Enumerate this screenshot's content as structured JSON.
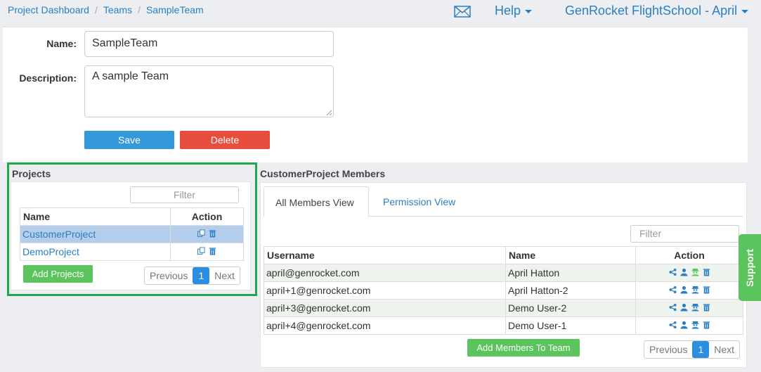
{
  "breadcrumb": [
    "Project Dashboard",
    "Teams",
    "SampleTeam"
  ],
  "header": {
    "help_label": "Help",
    "org_label": "GenRocket FlightSchool - April"
  },
  "form": {
    "name_label": "Name:",
    "name_value": "SampleTeam",
    "description_label": "Description:",
    "description_value": "A sample Team",
    "save_label": "Save",
    "delete_label": "Delete"
  },
  "projects": {
    "title": "Projects",
    "filter_placeholder": "Filter",
    "columns": [
      "Name",
      "Action"
    ],
    "rows": [
      "CustomerProject",
      "DemoProject"
    ],
    "add_label": "Add Projects",
    "pager": {
      "prev": "Previous",
      "page": "1",
      "next": "Next"
    }
  },
  "members": {
    "title": "CustomerProject Members",
    "tabs": [
      "All Members View",
      "Permission View"
    ],
    "filter_placeholder": "Filter",
    "columns": [
      "Username",
      "Name",
      "Action"
    ],
    "rows": [
      {
        "username": "april@genrocket.com",
        "name": "April Hatton"
      },
      {
        "username": "april+1@genrocket.com",
        "name": "April Hatton-2"
      },
      {
        "username": "april+3@genrocket.com",
        "name": "Demo User-2"
      },
      {
        "username": "april+4@genrocket.com",
        "name": "Demo User-1"
      }
    ],
    "add_label": "Add Members To Team",
    "pager": {
      "prev": "Previous",
      "page": "1",
      "next": "Next"
    }
  },
  "support_label": "Support",
  "colors": {
    "accent": "#2a7fc4",
    "save": "#3498db",
    "delete": "#e74c3c",
    "add": "#5cc45c",
    "highlight_border": "#1aaa4a"
  }
}
